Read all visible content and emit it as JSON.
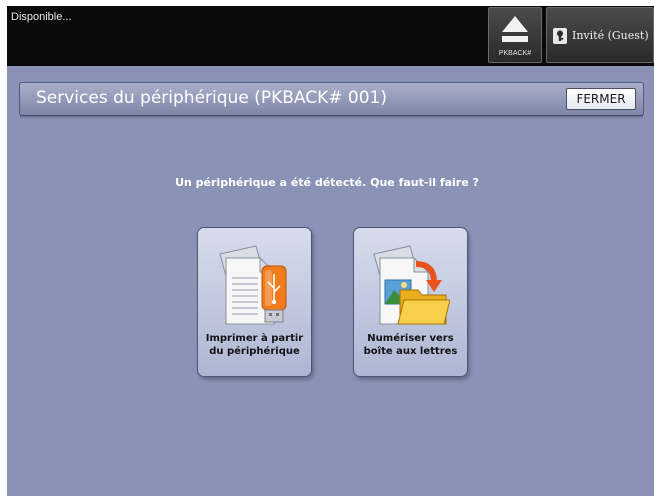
{
  "status": {
    "text": "Disponible..."
  },
  "topbar": {
    "eject_button": {
      "label": "PKBACK#",
      "icon": "eject-icon"
    },
    "user_button": {
      "label": "Invité (Guest)",
      "icon": "user-key-icon"
    }
  },
  "header": {
    "title": "Services du périphérique (PKBACK# 001)",
    "close_label": "FERMER"
  },
  "prompt": "Un périphérique a été détecté.  Que faut-il faire ?",
  "services": [
    {
      "line1": "Imprimer à partir",
      "line2": "du périphérique",
      "icon": "usb-document-icon"
    },
    {
      "line1": "Numériser vers",
      "line2": "boîte aux lettres",
      "icon": "scan-to-folder-icon"
    }
  ],
  "colors": {
    "background": "#8a93b5",
    "topbar": "#0a0a0a",
    "button_face": "#c4cbe2",
    "accent_orange": "#f07c1c",
    "folder_yellow": "#f4c534"
  }
}
